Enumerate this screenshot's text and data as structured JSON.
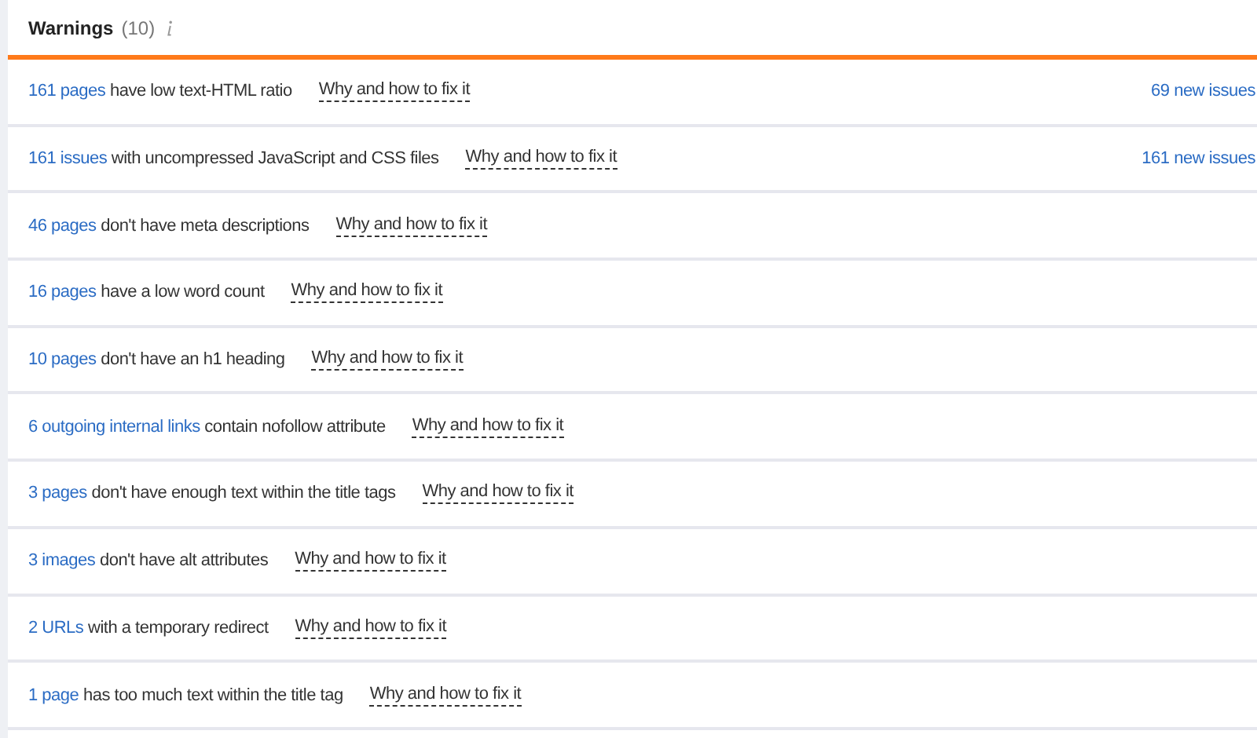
{
  "header": {
    "title": "Warnings",
    "count": "(10)"
  },
  "issues": [
    {
      "link": "161 pages",
      "text": "have low text-HTML ratio",
      "fix": "Why and how to fix it",
      "new_issues": "69 new issues"
    },
    {
      "link": "161 issues",
      "text": "with uncompressed JavaScript and CSS files",
      "fix": "Why and how to fix it",
      "new_issues": "161 new issues"
    },
    {
      "link": "46 pages",
      "text": "don't have meta descriptions",
      "fix": "Why and how to fix it"
    },
    {
      "link": "16 pages",
      "text": "have a low word count",
      "fix": "Why and how to fix it"
    },
    {
      "link": "10 pages",
      "text": "don't have an h1 heading",
      "fix": "Why and how to fix it"
    },
    {
      "link": "6 outgoing internal links",
      "text": "contain nofollow attribute",
      "fix": "Why and how to fix it"
    },
    {
      "link": "3 pages",
      "text": "don't have enough text within the title tags",
      "fix": "Why and how to fix it"
    },
    {
      "link": "3 images",
      "text": "don't have alt attributes",
      "fix": "Why and how to fix it"
    },
    {
      "link": "2 URLs",
      "text": "with a temporary redirect",
      "fix": "Why and how to fix it"
    },
    {
      "link": "1 page",
      "text": "has too much text within the title tag",
      "fix": "Why and how to fix it"
    }
  ]
}
